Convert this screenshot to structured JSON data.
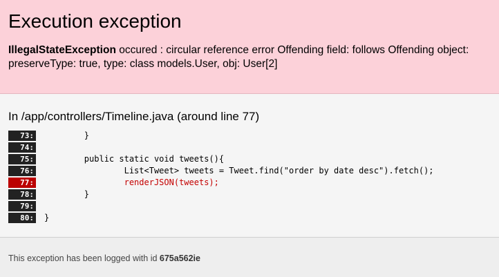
{
  "header": {
    "title": "Execution exception",
    "exception_name": "IllegalStateException",
    "exception_message": " occured : circular reference error Offending field: follows Offending object: preserveType: true, type: class models.User, obj: User[2]"
  },
  "source": {
    "title": "In /app/controllers/Timeline.java (around line 77)",
    "lines": [
      {
        "num": "73:",
        "code": "        }",
        "error": false
      },
      {
        "num": "74:",
        "code": "",
        "error": false
      },
      {
        "num": "75:",
        "code": "        public static void tweets(){",
        "error": false
      },
      {
        "num": "76:",
        "code": "                List<Tweet> tweets = Tweet.find(\"order by date desc\").fetch();",
        "error": false
      },
      {
        "num": "77:",
        "code": "                renderJSON(tweets);",
        "error": true
      },
      {
        "num": "78:",
        "code": "        }",
        "error": false
      },
      {
        "num": "79:",
        "code": "",
        "error": false
      },
      {
        "num": "80:",
        "code": "}",
        "error": false
      }
    ]
  },
  "footer": {
    "text": "This exception has been logged with id ",
    "log_id": "675a562ie"
  },
  "colors": {
    "header_bg": "#fcd1d9",
    "error_line": "#bb0000",
    "line_number_bg": "#222222"
  }
}
